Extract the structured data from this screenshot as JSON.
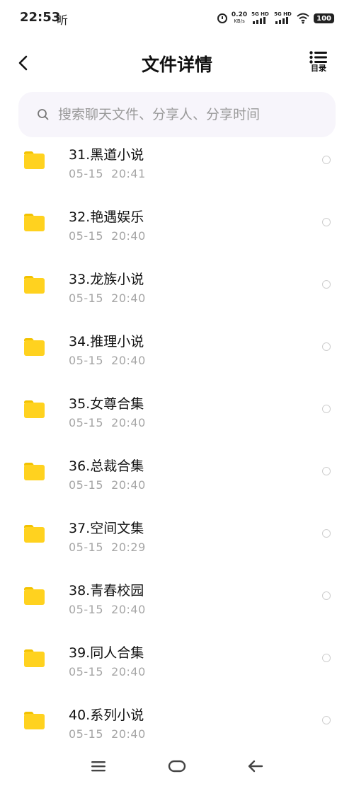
{
  "status_bar": {
    "time": "22:53",
    "listen_glyph": "听",
    "net_speed_value": "0.20",
    "net_speed_unit": "KB/s",
    "signal1_label": "5G HD",
    "signal2_label": "5G HD",
    "battery": "100",
    "icons": [
      "alarm-icon",
      "signal-icon",
      "signal-icon",
      "wifi-icon",
      "battery-icon"
    ]
  },
  "header": {
    "title": "文件详情",
    "back_icon": "chevron-left-icon",
    "toc_label": "目录",
    "toc_icon": "list-icon"
  },
  "search": {
    "placeholder": "搜索聊天文件、分享人、分享时间",
    "value": "",
    "icon": "search-icon"
  },
  "colors": {
    "folder": "#FFD21F",
    "folder_tab": "#F2C200",
    "date_text": "#A6A6A6",
    "search_bg": "#F7F5FB"
  },
  "files": [
    {
      "name": "31.黑道小说",
      "date": "05-15",
      "time": "20:41"
    },
    {
      "name": "32.艳遇娱乐",
      "date": "05-15",
      "time": "20:40"
    },
    {
      "name": "33.龙族小说",
      "date": "05-15",
      "time": "20:40"
    },
    {
      "name": "34.推理小说",
      "date": "05-15",
      "time": "20:40"
    },
    {
      "name": "35.女尊合集",
      "date": "05-15",
      "time": "20:40"
    },
    {
      "name": "36.总裁合集",
      "date": "05-15",
      "time": "20:40"
    },
    {
      "name": "37.空间文集",
      "date": "05-15",
      "time": "20:29"
    },
    {
      "name": "38.青春校园",
      "date": "05-15",
      "time": "20:40"
    },
    {
      "name": "39.同人合集",
      "date": "05-15",
      "time": "20:40"
    },
    {
      "name": "40.系列小说",
      "date": "05-15",
      "time": "20:40"
    }
  ],
  "nav_bar": {
    "icons": [
      "menu-icon",
      "home-icon",
      "back-arrow-icon"
    ]
  }
}
